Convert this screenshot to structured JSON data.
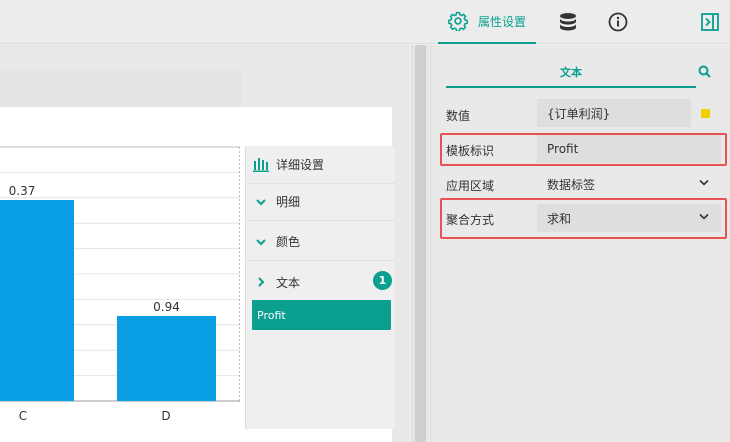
{
  "header": {
    "tabs": [
      {
        "label": "属性设置",
        "icon": "gear-icon",
        "active": true
      },
      {
        "label": "",
        "icon": "database-icon"
      },
      {
        "label": "",
        "icon": "info-icon"
      }
    ],
    "collapse_icon": "panel-collapse-icon",
    "accent_color": "#0a9f8f"
  },
  "chart_data": {
    "type": "bar",
    "categories": [
      "C",
      "D"
    ],
    "values": [
      0.37,
      0.94
    ],
    "data_labels": [
      "0.37",
      "0.94"
    ],
    "bar_color": "#0a9ee5",
    "grid": true
  },
  "floating_menu": {
    "header": "详细设置",
    "items": [
      {
        "label": "明细",
        "expanded": true
      },
      {
        "label": "颜色",
        "expanded": true
      },
      {
        "label": "文本",
        "expanded": false,
        "badge": "1"
      }
    ],
    "active_field": "Profit"
  },
  "properties": {
    "section_tab": "文本",
    "rows": [
      {
        "label": "数值",
        "value": "{订单利润}"
      },
      {
        "label": "模板标识",
        "value": "Profit"
      },
      {
        "label": "应用区域",
        "value": "数据标签"
      },
      {
        "label": "聚合方式",
        "value": "求和"
      }
    ]
  }
}
